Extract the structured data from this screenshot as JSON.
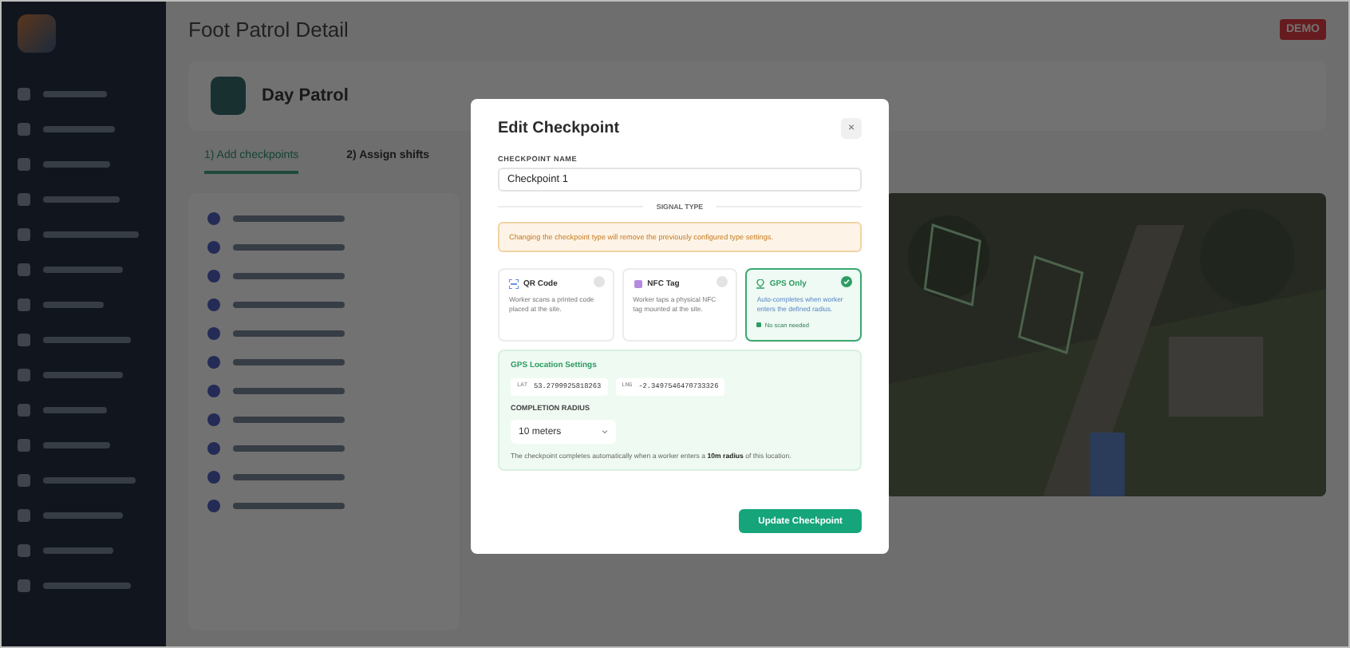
{
  "header": {
    "title": "Foot Patrol Detail",
    "badge": "DEMO"
  },
  "patrol": {
    "name": "Day Patrol"
  },
  "steps": [
    {
      "label": "1) Add checkpoints",
      "selected": true
    },
    {
      "label": "2) Assign shifts",
      "selected": false
    }
  ],
  "modal": {
    "title": "Edit Checkpoint",
    "close": "×",
    "name_label": "CHECKPOINT NAME",
    "name_value": "Checkpoint 1",
    "section": "SIGNAL TYPE",
    "warning": "Changing the checkpoint type will remove the previously configured type settings.",
    "signal_types": [
      {
        "kind": "qr",
        "title": "QR Code",
        "description": "Worker scans a printed code placed at the site.",
        "selected": false
      },
      {
        "kind": "nfc",
        "title": "NFC Tag",
        "description": "Worker taps a physical NFC tag mounted at the site.",
        "selected": false
      },
      {
        "kind": "gps",
        "title": "GPS Only",
        "description": "Auto-completes when worker enters the defined radius.",
        "note": "No scan needed",
        "selected": true
      }
    ],
    "gps": {
      "title": "GPS Location Settings",
      "lat_label": "LAT",
      "lat": "53.2799925818263",
      "lng_label": "LNG",
      "lng": "-2.3497546470733326",
      "radius_label": "COMPLETION RADIUS",
      "radius": "10 meters",
      "hint": "The checkpoint completes automatically when a worker enters a **10m radius** of this location."
    },
    "submit": "Update Checkpoint"
  }
}
